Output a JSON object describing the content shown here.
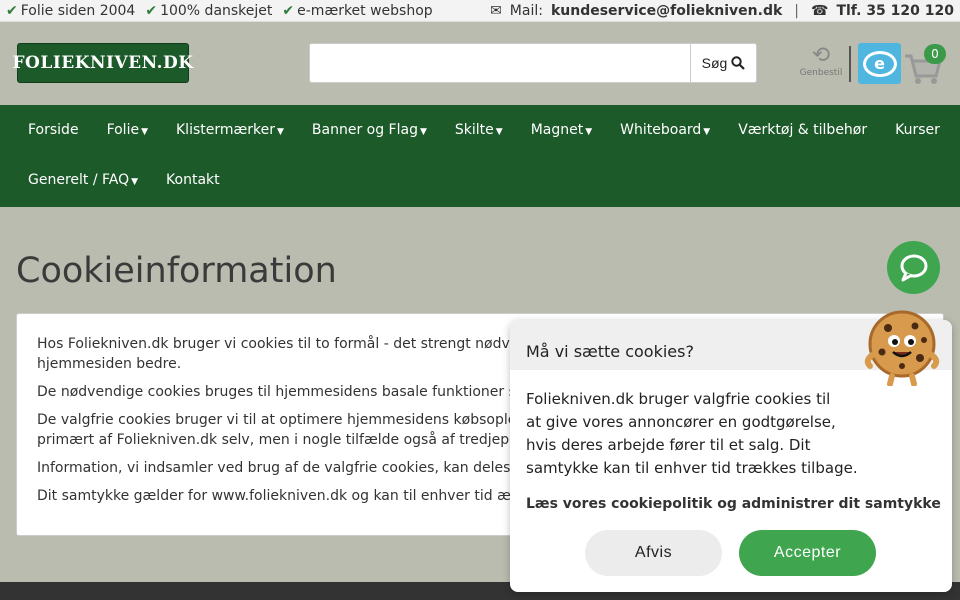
{
  "topbar": {
    "usps": [
      "Folie siden 2004",
      "100% danskejet",
      "e-mærket webshop"
    ],
    "mail_label": "Mail:",
    "mail": "kundeservice@foliekniven.dk",
    "divider": "|",
    "phone": "Tlf. 35 120 120"
  },
  "header": {
    "logo": "FOLIEKNIVEN.DK",
    "search_placeholder": "",
    "search_button": "Søg",
    "reorder_label": "Genbestil",
    "emark_letter": "e",
    "cart_count": "0"
  },
  "nav": {
    "row1": [
      {
        "label": "Forside",
        "caret": ""
      },
      {
        "label": "Folie",
        "caret": "▼"
      },
      {
        "label": "Klistermærker",
        "caret": "▼"
      },
      {
        "label": "Banner og Flag",
        "caret": "▼"
      },
      {
        "label": "Skilte",
        "caret": "▼"
      },
      {
        "label": "Magnet",
        "caret": "▼"
      },
      {
        "label": "Whiteboard",
        "caret": "▼"
      },
      {
        "label": "Værktøj & tilbehør",
        "caret": ""
      },
      {
        "label": "Kurser",
        "caret": ""
      }
    ],
    "row2": [
      {
        "label": "Generelt / FAQ",
        "caret": "▼"
      },
      {
        "label": "Kontakt",
        "caret": ""
      }
    ]
  },
  "page": {
    "title": "Cookieinformation",
    "paragraphs": [
      "Hos Foliekniven.dk bruger vi cookies til to formål - det strengt nødvendige",
      "hjemmesiden bedre.",
      "De nødvendige cookies bruges til hjemmesidens basale funktioner såson",
      "De valgfrie cookies bruger vi til at optimere hjemmesidens købsoplevelse",
      "primært af Foliekniven.dk selv, men i nogle tilfælde også af tredjeparter -",
      "Information, vi indsamler ved brug af de valgfrie cookies, kan deles med v",
      "Dit samtykke gælder for www.foliekniven.dk og kan til enhver tid ændres"
    ]
  },
  "cookie_dialog": {
    "title": "Må vi sætte cookies?",
    "body_lines": [
      "Foliekniven.dk bruger valgfrie cookies til",
      "at give vores annoncører en godtgørelse,",
      "hvis deres arbejde fører til et salg. Dit",
      "samtykke kan til enhver tid trækkes tilbage."
    ],
    "policy_link": "Læs vores cookiepolitik og administrer dit samtykke",
    "decline": "Afvis",
    "accept": "Accepter"
  },
  "colors": {
    "brand_green": "#1d5a2a",
    "accent_green": "#3fa54f",
    "page_bg": "#b9bcae",
    "emark_blue": "#4fb6e0"
  }
}
